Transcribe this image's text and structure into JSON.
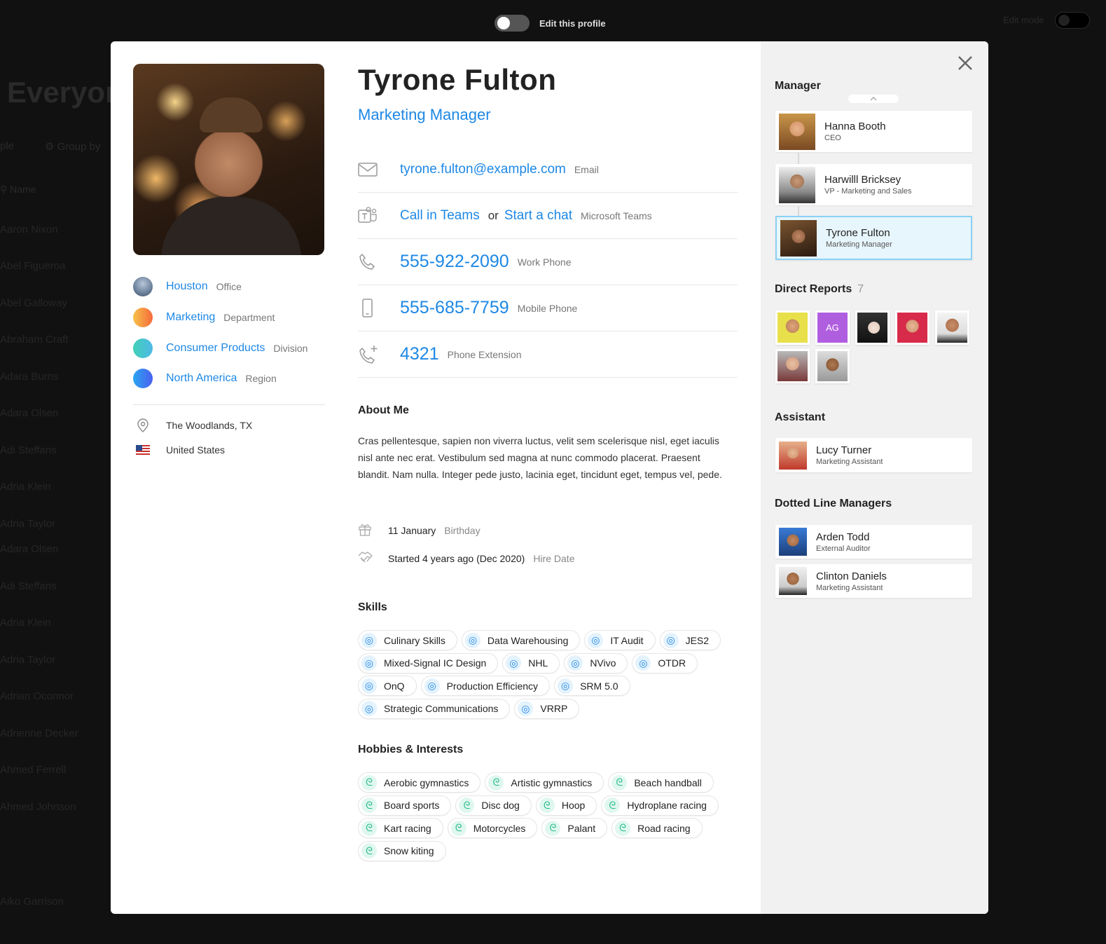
{
  "background": {
    "title": "Everyor",
    "search_hint": "ple",
    "group_by": "Group by",
    "name_header": "Name",
    "edit_mode": "Edit mode",
    "names": [
      "Aaron Nixon",
      "Abel Figueroa",
      "Abel Galloway",
      "Abraham Craft",
      "Adara Burns",
      "Adara Olsen",
      "Adi Steffans",
      "Adria Klein",
      "Adria Taylor",
      "Adara Olsen",
      "Adi Steffans",
      "Adria Klein",
      "Adria Taylor",
      "Adrian Oconnor",
      "Adrienne Decker",
      "Ahmed Ferrell",
      "Ahmed Johnson",
      "Aiko Garrison"
    ]
  },
  "topbar": {
    "toggle_label": "Edit this profile"
  },
  "profile": {
    "name": "Tyrone Fulton",
    "title": "Marketing Manager"
  },
  "org_info": [
    {
      "value": "Houston",
      "label": "Office",
      "color": "#6a7f9a"
    },
    {
      "value": "Marketing",
      "label": "Department",
      "color": "#f7a23a"
    },
    {
      "value": "Consumer Products",
      "label": "Division",
      "color": "#3cc6c0"
    },
    {
      "value": "North America",
      "label": "Region",
      "color": "#2f7fe6"
    }
  ],
  "location": {
    "city": "The Woodlands, TX",
    "country": "United States"
  },
  "contacts": {
    "email": {
      "value": "tyrone.fulton@example.com",
      "label": "Email"
    },
    "teams": {
      "call": "Call in Teams",
      "or": "or",
      "chat": "Start a chat",
      "label": "Microsoft Teams"
    },
    "work_phone": {
      "value": "555-922-2090",
      "label": "Work Phone"
    },
    "mobile_phone": {
      "value": "555-685-7759",
      "label": "Mobile Phone"
    },
    "extension": {
      "value": "4321",
      "label": "Phone Extension"
    }
  },
  "about": {
    "heading": "About Me",
    "text": "Cras pellentesque, sapien non viverra luctus, velit sem scelerisque nisl, eget iaculis nisl ante nec erat. Vestibulum sed magna at nunc commodo placerat. Praesent blandit. Nam nulla. Integer pede justo, lacinia eget, tincidunt eget, tempus vel, pede.",
    "birthday": {
      "value": "11 January",
      "label": "Birthday"
    },
    "hire": {
      "value": "Started 4 years ago (Dec 2020)",
      "label": "Hire Date"
    }
  },
  "skills": {
    "heading": "Skills",
    "items": [
      "Culinary Skills",
      "Data Warehousing",
      "IT Audit",
      "JES2",
      "Mixed-Signal IC Design",
      "NHL",
      "NVivo",
      "OTDR",
      "OnQ",
      "Production Efficiency",
      "SRM 5.0",
      "Strategic Communications",
      "VRRP"
    ]
  },
  "hobbies": {
    "heading": "Hobbies & Interests",
    "items": [
      "Aerobic gymnastics",
      "Artistic gymnastics",
      "Beach handball",
      "Board sports",
      "Disc dog",
      "Hoop",
      "Hydroplane racing",
      "Kart racing",
      "Motorcycles",
      "Palant",
      "Road racing",
      "Snow kiting"
    ]
  },
  "sidebar": {
    "manager_heading": "Manager",
    "chain": [
      {
        "name": "Hanna Booth",
        "role": "CEO"
      },
      {
        "name": "Harwilll Bricksey",
        "role": "VP - Marketing and Sales"
      },
      {
        "name": "Tyrone Fulton",
        "role": "Marketing Manager"
      }
    ],
    "direct_reports_heading": "Direct Reports",
    "direct_reports_count": "7",
    "direct_reports": [
      {
        "initials": ""
      },
      {
        "initials": "AG"
      },
      {
        "initials": ""
      },
      {
        "initials": ""
      },
      {
        "initials": ""
      },
      {
        "initials": ""
      },
      {
        "initials": ""
      }
    ],
    "assistant_heading": "Assistant",
    "assistant": {
      "name": "Lucy Turner",
      "role": "Marketing Assistant"
    },
    "dotted_heading": "Dotted Line Managers",
    "dotted": [
      {
        "name": "Arden Todd",
        "role": "External Auditor"
      },
      {
        "name": "Clinton Daniels",
        "role": "Marketing Assistant"
      }
    ]
  }
}
